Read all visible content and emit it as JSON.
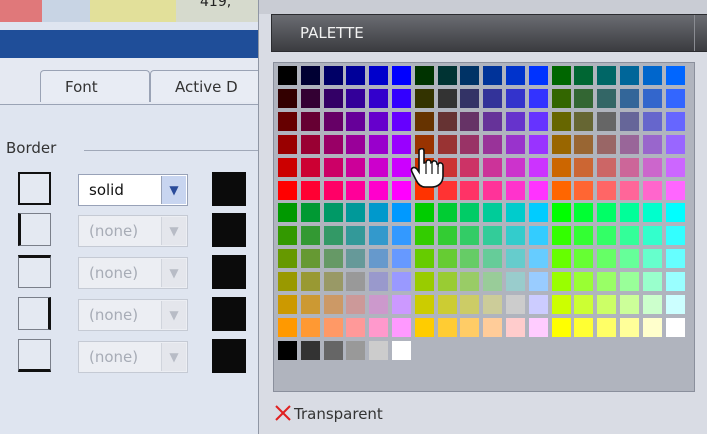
{
  "left": {
    "swatches": [
      "#e0787a",
      "#c8d4e4",
      "#e2e09a",
      "#d6dacd"
    ],
    "top_number": "419,",
    "tabs": [
      "Font",
      "Active D"
    ],
    "border_label": "Border",
    "style_rows": [
      {
        "value": "solid",
        "enabled": true
      },
      {
        "value": "(none)",
        "enabled": false
      },
      {
        "value": "(none)",
        "enabled": false
      },
      {
        "value": "(none)",
        "enabled": false
      },
      {
        "value": "(none)",
        "enabled": false
      }
    ]
  },
  "palette": {
    "title": "PALETTE",
    "transparent_label": "Transparent",
    "grid_rows": [
      [
        "#000000",
        "#000033",
        "#000066",
        "#000099",
        "#0000CC",
        "#0000FF",
        "#003300",
        "#003333",
        "#003366",
        "#003399",
        "#0033CC",
        "#0033FF",
        "#006600",
        "#006633",
        "#006666",
        "#006699",
        "#0066CC",
        "#0066FF"
      ],
      [
        "#330000",
        "#330033",
        "#330066",
        "#330099",
        "#3300CC",
        "#3300FF",
        "#333300",
        "#333333",
        "#333366",
        "#333399",
        "#3333CC",
        "#3333FF",
        "#336600",
        "#336633",
        "#336666",
        "#336699",
        "#3366CC",
        "#3366FF"
      ],
      [
        "#660000",
        "#660033",
        "#660066",
        "#660099",
        "#6600CC",
        "#6600FF",
        "#663300",
        "#663333",
        "#663366",
        "#663399",
        "#6633CC",
        "#6633FF",
        "#666600",
        "#666633",
        "#666666",
        "#666699",
        "#6666CC",
        "#6666FF"
      ],
      [
        "#990000",
        "#990033",
        "#990066",
        "#990099",
        "#9900CC",
        "#9900FF",
        "#993300",
        "#993333",
        "#993366",
        "#993399",
        "#9933CC",
        "#9933FF",
        "#996600",
        "#996633",
        "#996666",
        "#996699",
        "#9966CC",
        "#9966FF"
      ],
      [
        "#CC0000",
        "#CC0033",
        "#CC0066",
        "#CC0099",
        "#CC00CC",
        "#CC00FF",
        "#CC3300",
        "#CC3333",
        "#CC3366",
        "#CC3399",
        "#CC33CC",
        "#CC33FF",
        "#CC6600",
        "#CC6633",
        "#CC6666",
        "#CC6699",
        "#CC66CC",
        "#CC66FF"
      ],
      [
        "#FF0000",
        "#FF0033",
        "#FF0066",
        "#FF0099",
        "#FF00CC",
        "#FF00FF",
        "#FF3300",
        "#FF3333",
        "#FF3366",
        "#FF3399",
        "#FF33CC",
        "#FF33FF",
        "#FF6600",
        "#FF6633",
        "#FF6666",
        "#FF6699",
        "#FF66CC",
        "#FF66FF"
      ],
      [
        "#009900",
        "#009933",
        "#009966",
        "#009999",
        "#0099CC",
        "#0099FF",
        "#00CC00",
        "#00CC33",
        "#00CC66",
        "#00CC99",
        "#00CCCC",
        "#00CCFF",
        "#00FF00",
        "#00FF33",
        "#00FF66",
        "#00FF99",
        "#00FFCC",
        "#00FFFF"
      ],
      [
        "#339900",
        "#339933",
        "#339966",
        "#339999",
        "#3399CC",
        "#3399FF",
        "#33CC00",
        "#33CC33",
        "#33CC66",
        "#33CC99",
        "#33CCCC",
        "#33CCFF",
        "#33FF00",
        "#33FF33",
        "#33FF66",
        "#33FF99",
        "#33FFCC",
        "#33FFFF"
      ],
      [
        "#669900",
        "#669933",
        "#669966",
        "#669999",
        "#6699CC",
        "#6699FF",
        "#66CC00",
        "#66CC33",
        "#66CC66",
        "#66CC99",
        "#66CCCC",
        "#66CCFF",
        "#66FF00",
        "#66FF33",
        "#66FF66",
        "#66FF99",
        "#66FFCC",
        "#66FFFF"
      ],
      [
        "#999900",
        "#999933",
        "#999966",
        "#999999",
        "#9999CC",
        "#9999FF",
        "#99CC00",
        "#99CC33",
        "#99CC66",
        "#99CC99",
        "#99CCCC",
        "#99CCFF",
        "#99FF00",
        "#99FF33",
        "#99FF66",
        "#99FF99",
        "#99FFCC",
        "#99FFFF"
      ],
      [
        "#CC9900",
        "#CC9933",
        "#CC9966",
        "#CC9999",
        "#CC99CC",
        "#CC99FF",
        "#CCCC00",
        "#CCCC33",
        "#CCCC66",
        "#CCCC99",
        "#CCCCCC",
        "#CCCCFF",
        "#CCFF00",
        "#CCFF33",
        "#CCFF66",
        "#CCFF99",
        "#CCFFCC",
        "#CCFFFF"
      ],
      [
        "#FF9900",
        "#FF9933",
        "#FF9966",
        "#FF9999",
        "#FF99CC",
        "#FF99FF",
        "#FFCC00",
        "#FFCC33",
        "#FFCC66",
        "#FFCC99",
        "#FFCCCC",
        "#FFCCFF",
        "#FFFF00",
        "#FFFF33",
        "#FFFF66",
        "#FFFF99",
        "#FFFFCC",
        "#FFFFFF"
      ]
    ],
    "gray_row": [
      "#000000",
      "#333333",
      "#666666",
      "#999999",
      "#CCCCCC",
      "#FFFFFF"
    ]
  },
  "icons": {
    "transparent_icon": "red-x-icon",
    "cursor_icon": "hand-pointer-icon"
  }
}
